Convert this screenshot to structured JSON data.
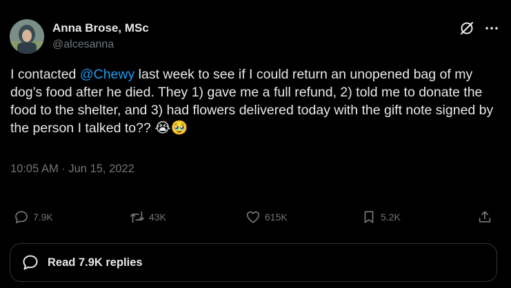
{
  "author": {
    "display_name": "Anna Brose, MSc",
    "handle": "@alcesanna",
    "avatar_icon": "user-avatar"
  },
  "tweet": {
    "text_before_mention": "I contacted ",
    "mention": "@Chewy",
    "text_after_mention": " last week to see if I could return an unopened bag of my dog’s food after he died. They 1) gave me a full refund, 2) told me to donate the food to the shelter, and 3) had flowers delivered today with the gift note signed by the person I talked to?? ",
    "emojis": "😭🥹",
    "timestamp": "10:05 AM · Jun 15, 2022"
  },
  "actions": {
    "replies": "7.9K",
    "retweets": "43K",
    "likes": "615K",
    "bookmarks": "5.2K"
  },
  "read_replies": {
    "label": "Read 7.9K replies"
  },
  "colors": {
    "background": "#000000",
    "text": "#e7e9ea",
    "muted": "#71767b",
    "accent": "#1d9bf0",
    "border": "#2f3336"
  }
}
